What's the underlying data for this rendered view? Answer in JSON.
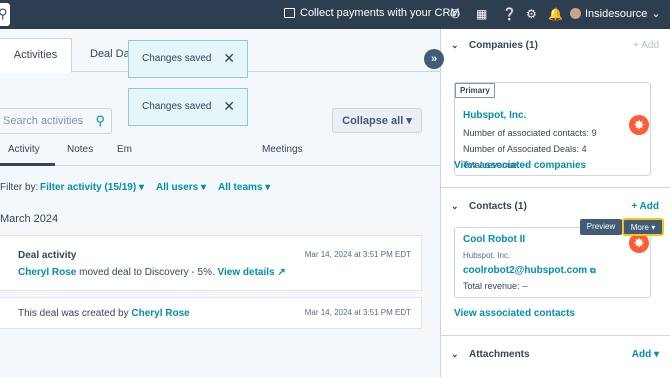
{
  "topnav": {
    "crm_link": "Collect payments with your CRM",
    "account_name": "Insidesource"
  },
  "left": {
    "tabs": [
      "Activities",
      "Deal Data"
    ],
    "search_placeholder": "Search activities",
    "collapse_label": "Collapse all",
    "subtabs": [
      "Activity",
      "Notes",
      "Em",
      "Meetings"
    ],
    "filter_by": "Filter by:",
    "filter_activity": "Filter activity (15/19)",
    "filter_users": "All users",
    "filter_teams": "All teams",
    "month": "March 2024",
    "cards": [
      {
        "title": "Deal activity",
        "timestamp": "Mar 14, 2024 at 3:51 PM EDT",
        "actor": "Cheryl Rose",
        "text": " moved deal to Discovery - 5%. ",
        "link": "View details"
      },
      {
        "timestamp": "Mar 14, 2024 at 3:51 PM EDT",
        "text": "This deal was created by ",
        "actor": "Cheryl Rose"
      }
    ]
  },
  "toasts": [
    "Changes saved",
    "Changes saved"
  ],
  "right": {
    "companies": {
      "header": "Companies (1)",
      "add": "+ Add",
      "primary_tag": "Primary",
      "name": "Hubspot, Inc.",
      "contacts_label": "Number of associated contacts:",
      "contacts_value": "9",
      "deals_label": "Number of Associated Deals:",
      "deals_value": "4",
      "revenue_label": "Total revenue:",
      "revenue_value": "--",
      "view_link": "View associated companies"
    },
    "contacts": {
      "header": "Contacts (1)",
      "add": "+ Add",
      "name": "Cool Robot II",
      "company": "Hubspot, Inc.",
      "email": "coolrobot2@hubspot.com",
      "revenue_label": "Total revenue:",
      "revenue_value": "--",
      "preview_label": "Preview",
      "more_label": "More",
      "view_link": "View associated contacts"
    },
    "attachments": {
      "header": "Attachments",
      "add": "Add"
    }
  },
  "colors": {
    "nav": "#2d3e50",
    "link": "#0091ae",
    "hubspot_orange": "#ff5c35",
    "highlight": "#f5c518"
  }
}
